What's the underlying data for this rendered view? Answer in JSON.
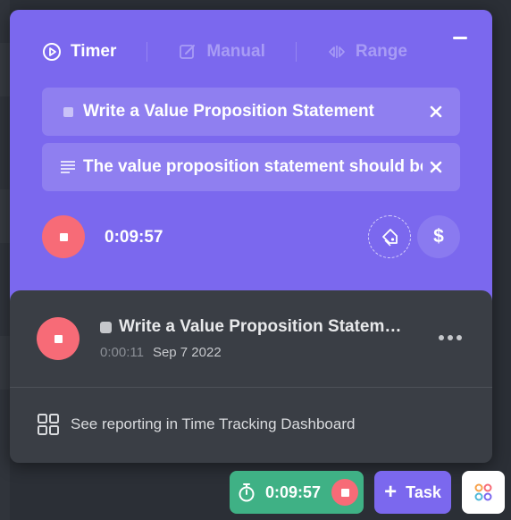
{
  "tabs": [
    {
      "label": "Timer",
      "icon": "play-circle-icon",
      "active": true
    },
    {
      "label": "Manual",
      "icon": "edit-icon",
      "active": false
    },
    {
      "label": "Range",
      "icon": "range-icon",
      "active": false
    }
  ],
  "task_field": {
    "value": "Write a Value Proposition Statement"
  },
  "description_field": {
    "value": "The value proposition statement should be"
  },
  "timer": {
    "elapsed": "0:09:57"
  },
  "billable_symbol": "$",
  "entry": {
    "title": "Write a Value Proposition Statement",
    "duration": "0:00:11",
    "date": "Sep 7 2022"
  },
  "report_link": "See reporting in Time Tracking Dashboard",
  "bottom_bar": {
    "timer_value": "0:09:57",
    "task_label": "Task"
  },
  "colors": {
    "accent": "#7b68ee",
    "stop": "#f76b77",
    "timer_green": "#3fb185",
    "dark_panel": "#3a3e45"
  }
}
